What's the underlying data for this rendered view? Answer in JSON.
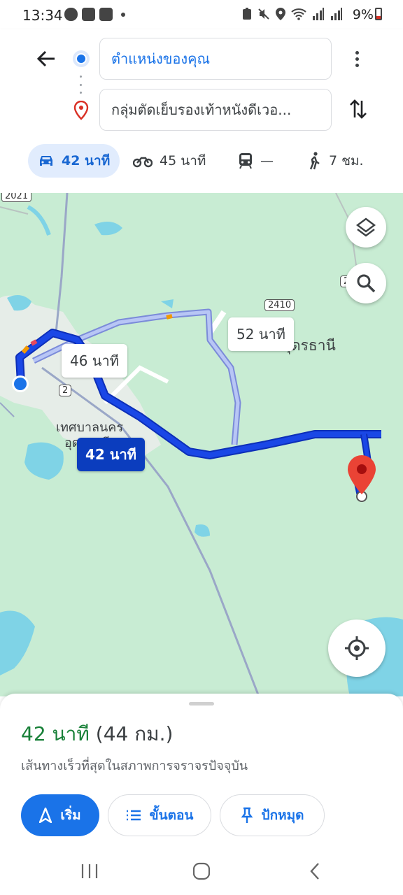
{
  "status_bar": {
    "time": "13:34",
    "battery": "9%",
    "icons": [
      "line-icon",
      "seven-eleven-icon",
      "voicemail-icon",
      "dot-icon",
      "battery-saver-icon",
      "mute-icon",
      "location-icon",
      "wifi-icon",
      "signal-icon",
      "signal-icon"
    ]
  },
  "search": {
    "origin": "ตำแหน่งของคุณ",
    "destination": "กลุ่มตัดเย็บรองเท้าหนังดีเวอ...",
    "icons": {
      "back": "back-arrow-icon",
      "more": "more-vert-icon",
      "swap": "swap-vert-icon",
      "destination": "destination-pin-icon"
    }
  },
  "modes": [
    {
      "icon": "car-icon",
      "label": "42 นาที",
      "selected": true
    },
    {
      "icon": "motorcycle-icon",
      "label": "45 นาที",
      "selected": false
    },
    {
      "icon": "transit-icon",
      "label": "—",
      "selected": false
    },
    {
      "icon": "walk-icon",
      "label": "7 ชม.",
      "selected": false
    }
  ],
  "map": {
    "route_labels": {
      "primary": "42 นาที",
      "alt1": "46 นาที",
      "alt2": "52 นาที"
    },
    "places": {
      "city_line1": "เทศบาลนคร",
      "city_line2": "อุดรธานี",
      "province": "ุดรธานี"
    },
    "road_shields": [
      "2021",
      "2410",
      "2",
      "2"
    ],
    "buttons": {
      "layers": "layers-icon",
      "search": "search-icon",
      "my_location": "my-location-icon"
    },
    "colors": {
      "land": "#c8ecd3",
      "water": "#7fd3e6",
      "route": "#1a47e6",
      "alt_route": "#a8b8f0",
      "pin": "#ea4335"
    }
  },
  "sheet": {
    "duration": "42 นาที",
    "distance": "(44 กม.)",
    "note": "เส้นทางเร็วที่สุดในสภาพการจราจรปัจจุบัน",
    "buttons": {
      "start": "เริ่ม",
      "steps": "ขั้นตอน",
      "pin": "ปักหมุด"
    }
  },
  "navbar": {
    "recent": "recents-icon",
    "home": "home-icon",
    "back": "nav-back-icon"
  }
}
